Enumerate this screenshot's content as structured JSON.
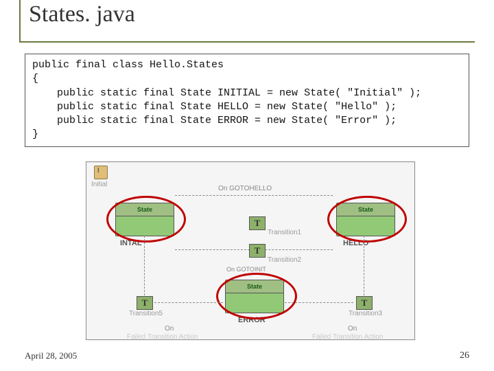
{
  "title": "States. java",
  "code": "public final class Hello.States\n{\n    public static final State INITIAL = new State( \"Initial\" );\n    public static final State HELLO = new State( \"Hello\" );\n    public static final State ERROR = new State( \"Error\" );\n}",
  "diagram": {
    "init_label": "Initial",
    "on_gotohello": "On GOTOHELLO",
    "state_prefix": "State",
    "states": {
      "intal": "INTAL",
      "hello": "HELLO",
      "error": "ERROR"
    },
    "transitions": {
      "t1": "Transition1",
      "t2": "Transition2",
      "t3": "Transition3",
      "t5": "Transition5"
    },
    "on_gotoinit": "On GOTOINIT",
    "on_failed": "On",
    "failed_ta": "Failed Transition Action",
    "t_letter": "T",
    "i_letter": "I"
  },
  "footer": {
    "date": "April 28, 2005",
    "page": "26"
  }
}
